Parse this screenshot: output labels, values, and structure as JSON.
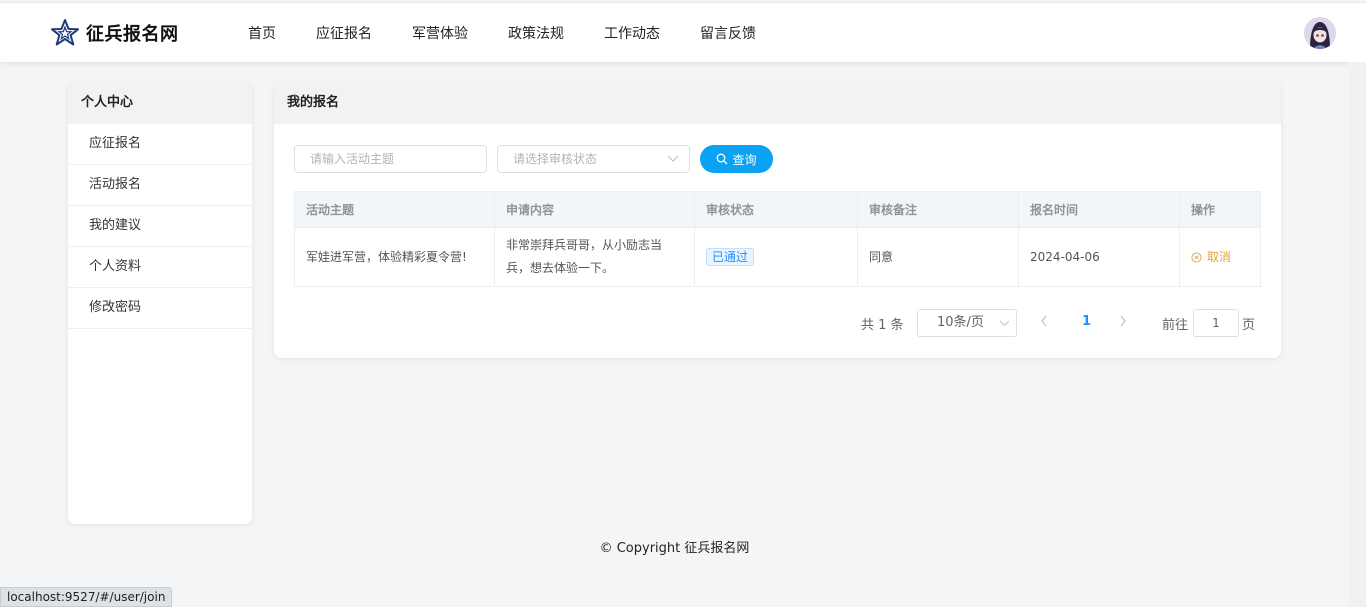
{
  "header": {
    "logo_text": "征兵报名网",
    "nav": [
      "首页",
      "应征报名",
      "军营体验",
      "政策法规",
      "工作动态",
      "留言反馈"
    ]
  },
  "sidebar": {
    "title": "个人中心",
    "items": [
      "应征报名",
      "活动报名",
      "我的建议",
      "个人资料",
      "修改密码"
    ]
  },
  "main": {
    "title": "我的报名",
    "search": {
      "theme_placeholder": "请输入活动主题",
      "status_placeholder": "请选择审核状态",
      "button_label": "查询"
    },
    "table": {
      "columns": [
        "活动主题",
        "申请内容",
        "审核状态",
        "审核备注",
        "报名时间",
        "操作"
      ],
      "rows": [
        {
          "theme": "军娃进军营，体验精彩夏令营!",
          "content_line1": "非常崇拜兵哥哥，从小励志当",
          "content_line2": "兵，想去体验一下。",
          "status": "已通过",
          "remark": "同意",
          "time": "2024-04-06",
          "action": "取消"
        }
      ]
    },
    "pagination": {
      "total": "共 1 条",
      "page_size": "10条/页",
      "current_page": "1",
      "goto_label": "前往",
      "goto_value": "1",
      "page_suffix": "页"
    }
  },
  "footer": {
    "copyright": "© Copyright 征兵报名网"
  },
  "status_bar": {
    "url": "localhost:9527/#/user/join"
  },
  "colors": {
    "accent": "#0aa2f3",
    "link": "#1890ff",
    "warning": "#e6a23c"
  }
}
